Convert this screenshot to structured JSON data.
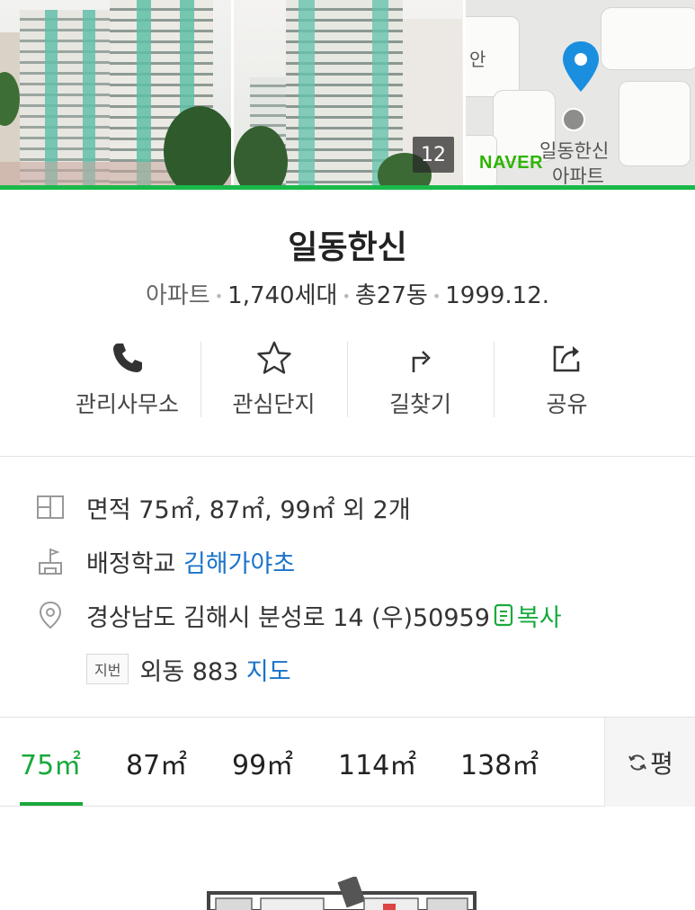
{
  "gallery": {
    "photo_count": "12",
    "map_labels": {
      "corner_text": "안",
      "apt_name": "일동한신",
      "apt_type": "아파트",
      "brand": "NAVER"
    }
  },
  "complex": {
    "name": "일동한신",
    "type": "아파트",
    "households": "1,740세대",
    "buildings": "총27동",
    "completed": "1999.12."
  },
  "actions": [
    {
      "label": "관리사무소",
      "icon": "phone-icon"
    },
    {
      "label": "관심단지",
      "icon": "star-icon"
    },
    {
      "label": "길찾기",
      "icon": "directions-icon"
    },
    {
      "label": "공유",
      "icon": "share-icon"
    }
  ],
  "info": {
    "area_label": "면적",
    "area_value": "75㎡, 87㎡, 99㎡ 외 2개",
    "school_label": "배정학교",
    "school_value": "김해가야초",
    "address": "경상남도 김해시 분성로 14 (우)50959",
    "copy_label": "복사",
    "jibun_badge": "지번",
    "jibun_value": "외동 883",
    "map_link": "지도"
  },
  "area_tabs": {
    "items": [
      "75㎡",
      "87㎡",
      "99㎡",
      "114㎡",
      "138㎡"
    ],
    "selected": "75㎡",
    "unit_toggle": "평"
  },
  "colors": {
    "accent_green": "#19a93d",
    "brand_green": "#19b94a",
    "link_blue": "#1a73c9",
    "pin_blue": "#1a8fe0"
  }
}
